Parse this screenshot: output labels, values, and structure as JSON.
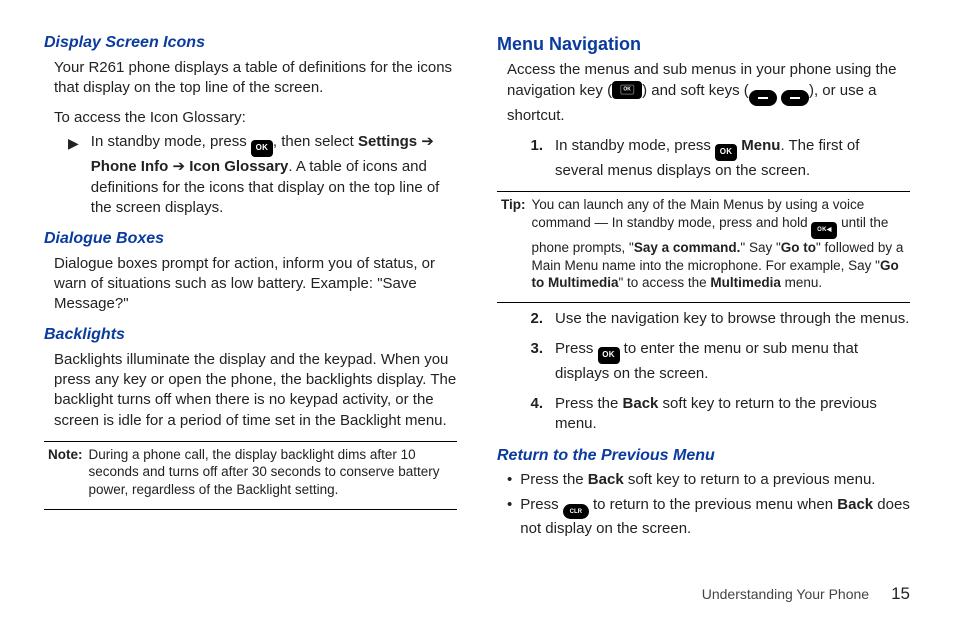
{
  "left": {
    "h1": "Display Screen Icons",
    "p1": "Your R261 phone displays a table of definitions for the icons that display on the top line of the screen.",
    "p2": "To access the Icon Glossary:",
    "step_pre": "In standby mode, press ",
    "step_mid": ", then select ",
    "step_b1a": "Settings",
    "step_arrow": " ➔ ",
    "step_b1b": "Phone Info",
    "step_b1c": "Icon Glossary",
    "step_post": ". A table of icons and definitions for the icons that display on the top line of the screen displays.",
    "h2": "Dialogue Boxes",
    "p3": "Dialogue boxes prompt for action, inform you of status, or warn of situations such as low battery. Example: \"Save Message?\"",
    "h3": "Backlights",
    "p4": "Backlights illuminate the display and the keypad. When you press any key or open the phone, the backlights display. The backlight turns off when there is no keypad activity, or the screen is idle for a period of time set in the Backlight menu.",
    "note_label": "Note:",
    "note_body": "During a phone call, the display backlight dims after 10 seconds and turns off after 30 seconds to conserve battery power, regardless of the Backlight setting."
  },
  "right": {
    "h1": "Menu Navigation",
    "p1a": "Access the menus and sub menus in your phone using the navigation key (",
    "p1b": ") and soft keys (",
    "p1c": "), or use a shortcut.",
    "s1_num": "1.",
    "s1_a": "In standby mode, press ",
    "s1_b": " Menu",
    "s1_c": ". The first of several menus displays on the screen.",
    "tip_label": "Tip:",
    "tip_a": "You can launch any of the Main Menus by using a voice command — In standby mode, press and hold ",
    "tip_b": " until the phone prompts, \"",
    "tip_c": "Say a command.",
    "tip_d": "\" Say \"",
    "tip_e": "Go to",
    "tip_f": "\" followed by a Main Menu name into the microphone. For example, Say \"",
    "tip_g": "Go to Multimedia",
    "tip_h": "\" to access the ",
    "tip_i": "Multimedia",
    "tip_j": " menu.",
    "s2_num": "2.",
    "s2": "Use the navigation key to browse through the menus.",
    "s3_num": "3.",
    "s3_a": "Press ",
    "s3_b": " to enter the menu or sub menu that displays on the screen.",
    "s4_num": "4.",
    "s4_a": "Press the ",
    "s4_b": "Back",
    "s4_c": " soft key to return to the previous menu.",
    "h2": "Return to the Previous Menu",
    "b1_a": "Press the ",
    "b1_b": "Back",
    "b1_c": " soft key to return to a previous menu.",
    "b2_a": "Press ",
    "b2_b": " to return to the previous menu when ",
    "b2_c": "Back",
    "b2_d": " does not display on the screen."
  },
  "footer": {
    "section": "Understanding Your Phone",
    "page": "15"
  }
}
